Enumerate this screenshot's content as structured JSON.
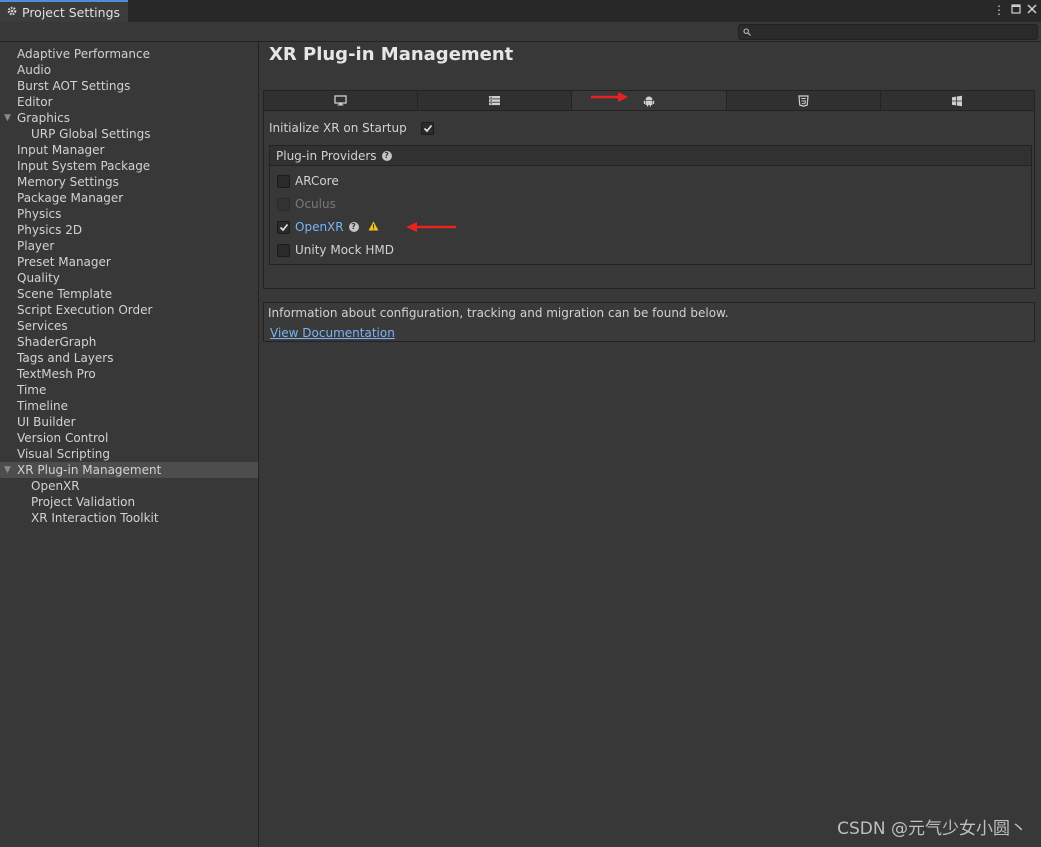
{
  "window": {
    "tab_title": "Project Settings",
    "gear_icon": "gear-icon",
    "controls": {
      "menu_icon": "kebab-menu-icon",
      "maximize_icon": "maximize-icon",
      "close_icon": "close-icon"
    }
  },
  "search": {
    "placeholder": "",
    "value": ""
  },
  "sidebar": {
    "items": [
      {
        "label": "Adaptive Performance"
      },
      {
        "label": "Audio"
      },
      {
        "label": "Burst AOT Settings"
      },
      {
        "label": "Editor"
      },
      {
        "label": "Graphics",
        "expanded": true
      },
      {
        "label": "URP Global Settings",
        "child": true
      },
      {
        "label": "Input Manager"
      },
      {
        "label": "Input System Package"
      },
      {
        "label": "Memory Settings"
      },
      {
        "label": "Package Manager"
      },
      {
        "label": "Physics"
      },
      {
        "label": "Physics 2D"
      },
      {
        "label": "Player"
      },
      {
        "label": "Preset Manager"
      },
      {
        "label": "Quality"
      },
      {
        "label": "Scene Template"
      },
      {
        "label": "Script Execution Order"
      },
      {
        "label": "Services"
      },
      {
        "label": "ShaderGraph"
      },
      {
        "label": "Tags and Layers"
      },
      {
        "label": "TextMesh Pro"
      },
      {
        "label": "Time"
      },
      {
        "label": "Timeline"
      },
      {
        "label": "UI Builder"
      },
      {
        "label": "Version Control"
      },
      {
        "label": "Visual Scripting"
      },
      {
        "label": "XR Plug-in Management",
        "expanded": true,
        "selected": true
      },
      {
        "label": "OpenXR",
        "child": true
      },
      {
        "label": "Project Validation",
        "child": true
      },
      {
        "label": "XR Interaction Toolkit",
        "child": true
      }
    ]
  },
  "main": {
    "title": "XR Plug-in Management",
    "platform_tabs": [
      {
        "icon": "desktop-monitor-icon",
        "active": false
      },
      {
        "icon": "server-rack-icon",
        "active": false
      },
      {
        "icon": "android-icon",
        "active": true
      },
      {
        "icon": "html5-icon",
        "active": false
      },
      {
        "icon": "windows-logo-icon",
        "active": false
      }
    ],
    "initialize_xr": {
      "label": "Initialize XR on Startup",
      "checked": true
    },
    "providers": {
      "header": "Plug-in Providers",
      "items": [
        {
          "label": "ARCore",
          "checked": false,
          "disabled": false
        },
        {
          "label": "Oculus",
          "checked": false,
          "disabled": true
        },
        {
          "label": "OpenXR",
          "checked": true,
          "disabled": false,
          "help": true,
          "warning": true
        },
        {
          "label": "Unity Mock HMD",
          "checked": false,
          "disabled": false
        }
      ]
    },
    "info": {
      "text": "Information about configuration, tracking and migration can be found below.",
      "link": "View Documentation"
    }
  },
  "colors": {
    "accent_link": "#7ab4f6",
    "warning": "#f5c518",
    "annotation_arrow": "#e8231f"
  },
  "watermark": "CSDN @元气少女小圆丶"
}
